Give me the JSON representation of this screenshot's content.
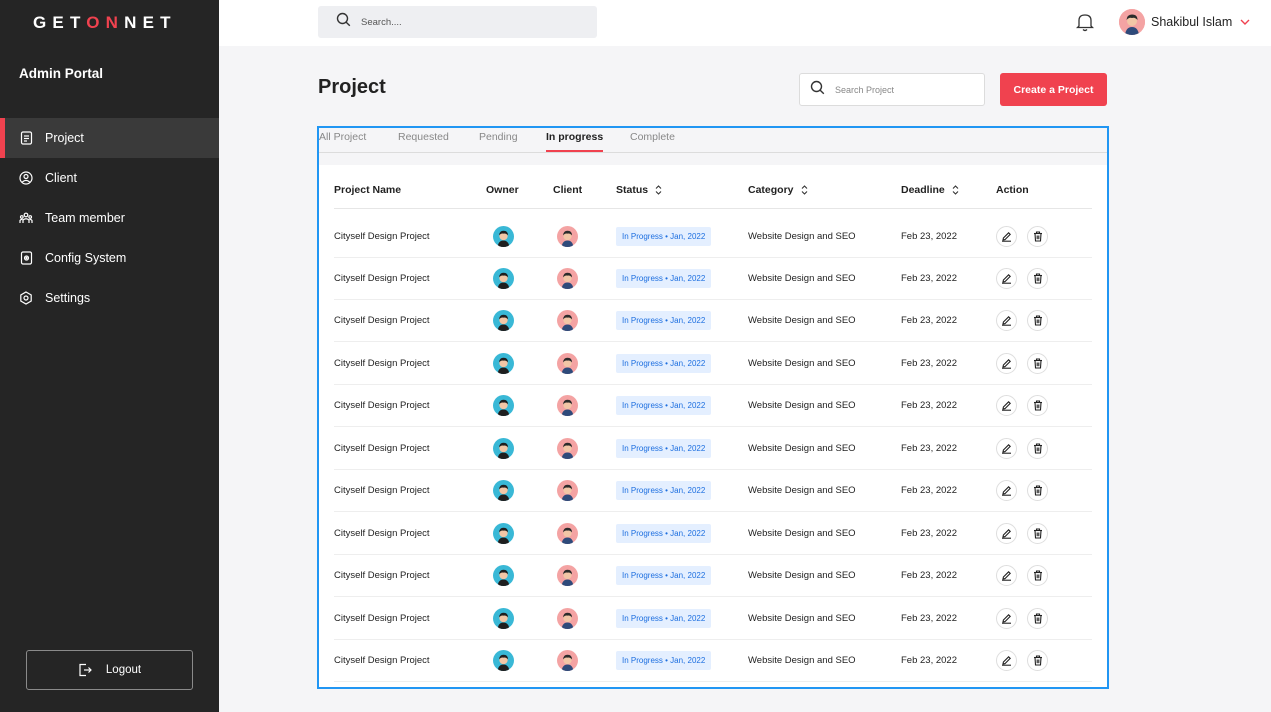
{
  "brand": {
    "logo_part1": "GET",
    "logo_part2": "ON",
    "logo_part3": "NET",
    "accent_color": "#f0424f"
  },
  "sidebar": {
    "title": "Admin Portal",
    "items": [
      {
        "label": "Project",
        "icon": "document-icon",
        "active": true
      },
      {
        "label": "Client",
        "icon": "user-circle-icon"
      },
      {
        "label": "Team member",
        "icon": "team-icon"
      },
      {
        "label": "Config System",
        "icon": "config-icon"
      },
      {
        "label": "Settings",
        "icon": "gear-icon"
      }
    ],
    "logout_label": "Logout"
  },
  "topbar": {
    "search_placeholder": "Search....",
    "user_name": "Shakibul Islam"
  },
  "page": {
    "title": "Project",
    "search_placeholder": "Search Project",
    "create_label": "Create a Project"
  },
  "tabs": [
    {
      "label": "All Project"
    },
    {
      "label": "Requested"
    },
    {
      "label": "Pending"
    },
    {
      "label": "In progress",
      "active": true
    },
    {
      "label": "Complete"
    }
  ],
  "table": {
    "columns": [
      "Project Name",
      "Owner",
      "Client",
      "Status",
      "Category",
      "Deadline",
      "Action"
    ],
    "rows": [
      {
        "name": "Cityself Design Project",
        "status": "In Progress • Jan, 2022",
        "category": "Website Design and SEO",
        "deadline": "Feb 23, 2022"
      },
      {
        "name": "Cityself Design Project",
        "status": "In Progress • Jan, 2022",
        "category": "Website Design and SEO",
        "deadline": "Feb 23, 2022"
      },
      {
        "name": "Cityself Design Project",
        "status": "In Progress • Jan, 2022",
        "category": "Website Design and SEO",
        "deadline": "Feb 23, 2022"
      },
      {
        "name": "Cityself Design Project",
        "status": "In Progress • Jan, 2022",
        "category": "Website Design and SEO",
        "deadline": "Feb 23, 2022"
      },
      {
        "name": "Cityself Design Project",
        "status": "In Progress • Jan, 2022",
        "category": "Website Design and SEO",
        "deadline": "Feb 23, 2022"
      },
      {
        "name": "Cityself Design Project",
        "status": "In Progress • Jan, 2022",
        "category": "Website Design and SEO",
        "deadline": "Feb 23, 2022"
      },
      {
        "name": "Cityself Design Project",
        "status": "In Progress • Jan, 2022",
        "category": "Website Design and SEO",
        "deadline": "Feb 23, 2022"
      },
      {
        "name": "Cityself Design Project",
        "status": "In Progress • Jan, 2022",
        "category": "Website Design and SEO",
        "deadline": "Feb 23, 2022"
      },
      {
        "name": "Cityself Design Project",
        "status": "In Progress • Jan, 2022",
        "category": "Website Design and SEO",
        "deadline": "Feb 23, 2022"
      },
      {
        "name": "Cityself Design Project",
        "status": "In Progress • Jan, 2022",
        "category": "Website Design and SEO",
        "deadline": "Feb 23, 2022"
      },
      {
        "name": "Cityself Design Project",
        "status": "In Progress • Jan, 2022",
        "category": "Website Design and SEO",
        "deadline": "Feb 23, 2022"
      }
    ]
  }
}
